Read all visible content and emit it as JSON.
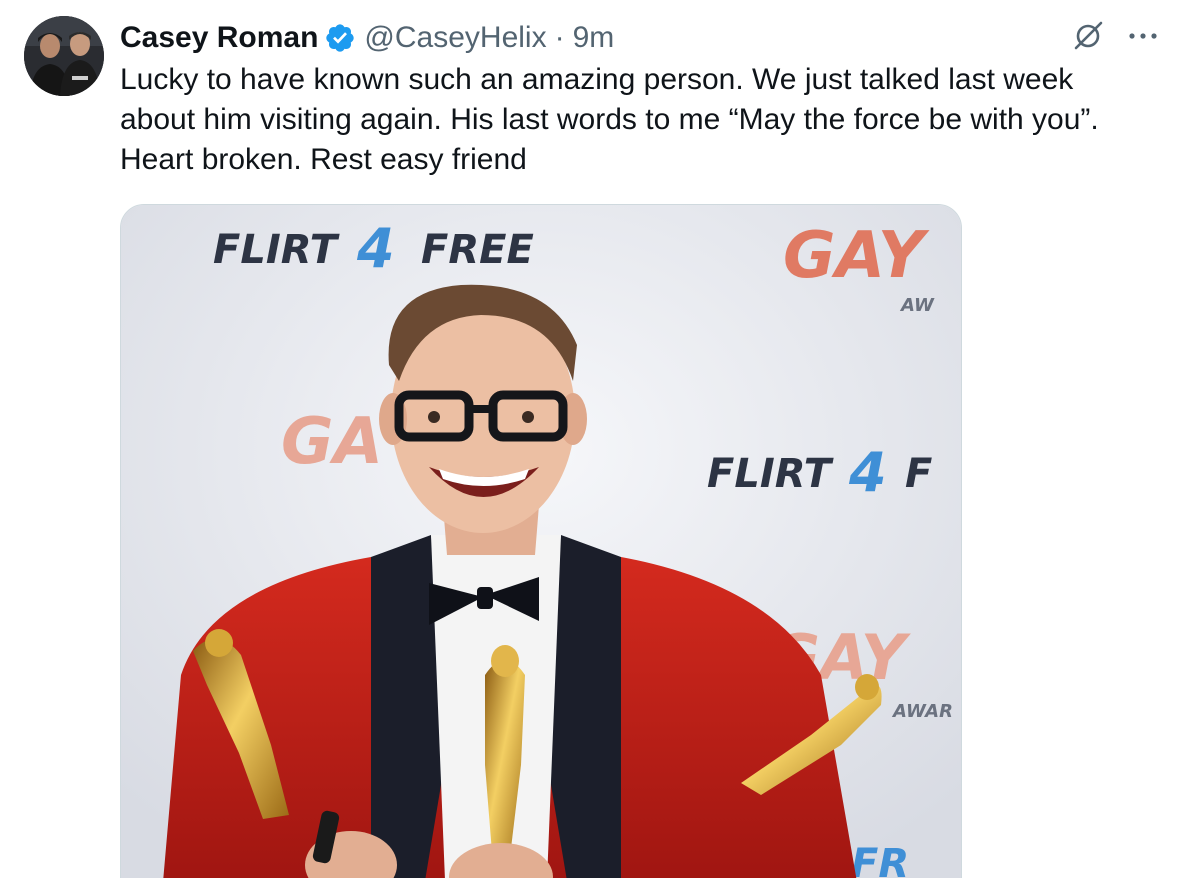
{
  "tweet": {
    "author": {
      "display_name": "Casey Roman",
      "handle": "@CaseyHelix",
      "verified": true
    },
    "separator": "·",
    "time": "9m",
    "text_lines": [
      "Lucky to have known such an amazing person.  We just talked last week",
      "about him visiting again.  His last words to me “May the force be with you”.",
      "Heart broken. Rest easy friend"
    ],
    "icons": {
      "avatar": "avatar",
      "verified": "verified-badge-icon",
      "grok": "grok-icon",
      "more": "more-options-icon"
    },
    "colors": {
      "text": "#0f1419",
      "secondary": "#536471",
      "verified_blue": "#1d9bf0",
      "border": "#cfd9de"
    },
    "media": {
      "backdrop_logos": {
        "flirt_a": "FLIRT",
        "flirt_4": "4",
        "flirt_b": "FREE",
        "flirt_partial": "FLIRT",
        "flirt_partial_4": "4",
        "flirt_partial_b": "F",
        "gay_top": "GAY",
        "aw_top": "AW",
        "gay_mid": "GA",
        "gay_low": "GAY",
        "awar_low": "AWAR",
        "fr_bottom": "FR"
      }
    }
  }
}
